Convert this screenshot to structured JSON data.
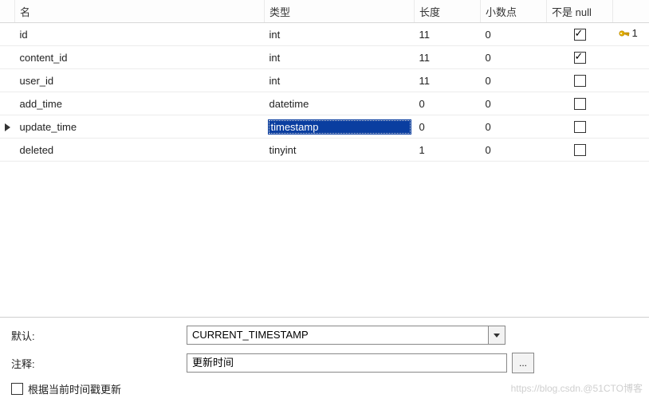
{
  "headers": {
    "name": "名",
    "type": "类型",
    "length": "长度",
    "decimals": "小数点",
    "notnull": "不是 null"
  },
  "rows": [
    {
      "name": "id",
      "type": "int",
      "len": "11",
      "dec": "0",
      "nn": true,
      "pk": true,
      "sel": false,
      "editType": false
    },
    {
      "name": "content_id",
      "type": "int",
      "len": "11",
      "dec": "0",
      "nn": true,
      "pk": false,
      "sel": false,
      "editType": false
    },
    {
      "name": "user_id",
      "type": "int",
      "len": "11",
      "dec": "0",
      "nn": false,
      "pk": false,
      "sel": false,
      "editType": false
    },
    {
      "name": "add_time",
      "type": "datetime",
      "len": "0",
      "dec": "0",
      "nn": false,
      "pk": false,
      "sel": false,
      "editType": false
    },
    {
      "name": "update_time",
      "type": "timestamp",
      "len": "0",
      "dec": "0",
      "nn": false,
      "pk": false,
      "sel": true,
      "editType": true
    },
    {
      "name": "deleted",
      "type": "tinyint",
      "len": "1",
      "dec": "0",
      "nn": false,
      "pk": false,
      "sel": false,
      "editType": false
    }
  ],
  "pkIndex": "1",
  "props": {
    "defaultLabel": "默认:",
    "defaultValue": "CURRENT_TIMESTAMP",
    "commentLabel": "注释:",
    "commentValue": "更新时间",
    "onUpdateLabel": "根据当前时间戳更新"
  },
  "watermark": "https://blog.csdn.@51CTO博客"
}
